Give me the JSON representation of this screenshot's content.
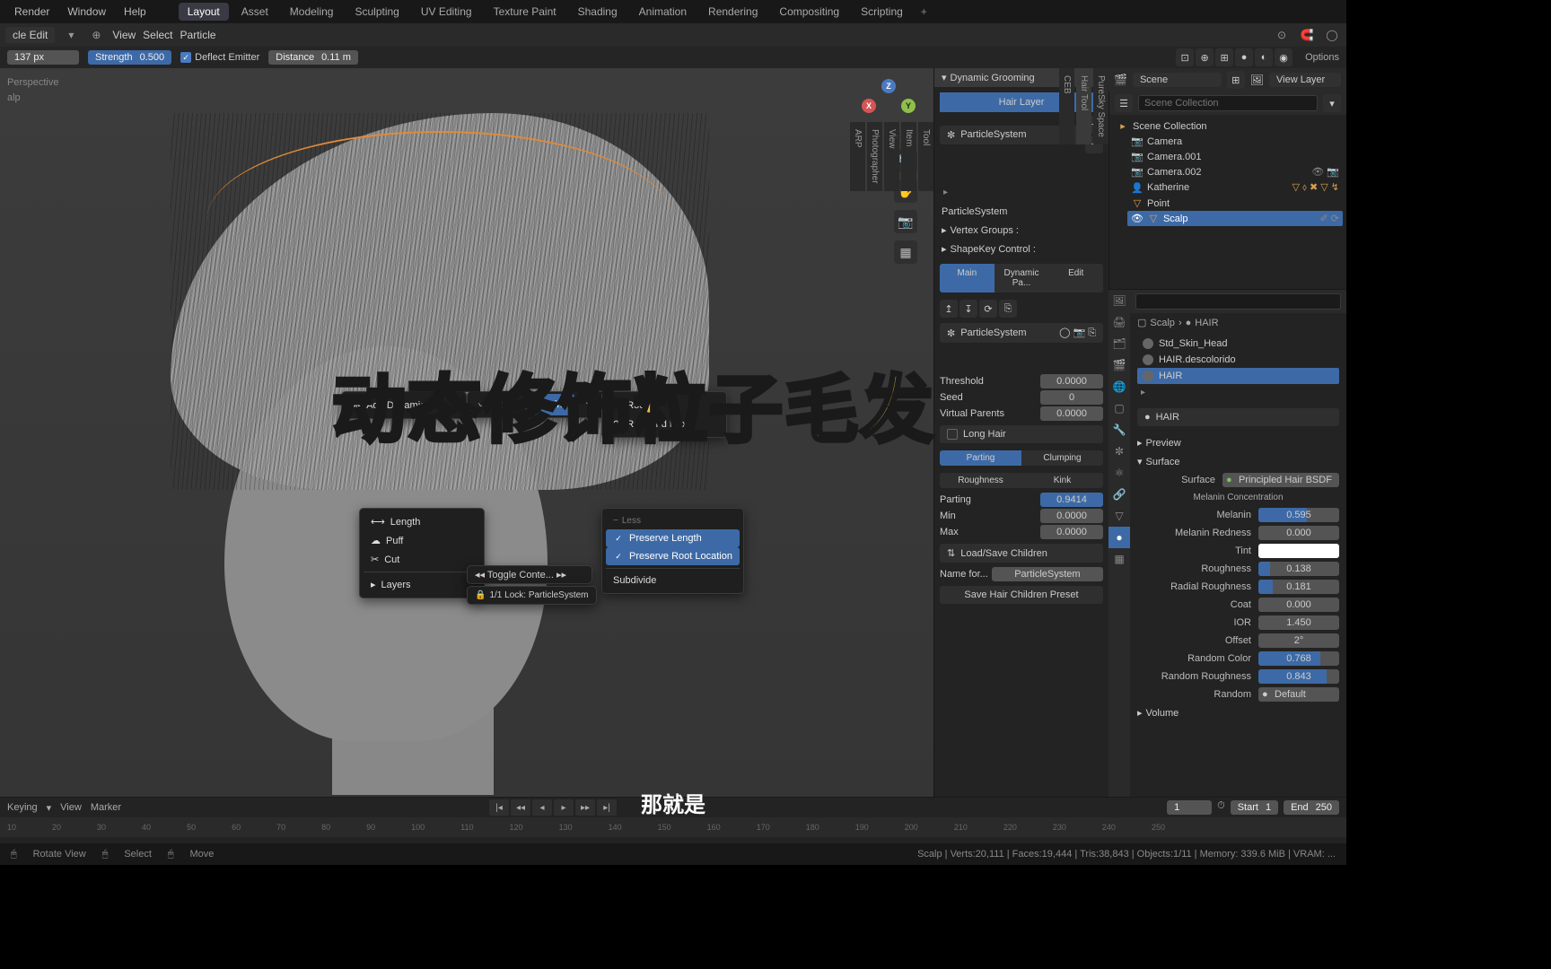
{
  "topmenu": [
    "Render",
    "Window",
    "Help"
  ],
  "workspaces": [
    "Layout",
    "Asset",
    "Modeling",
    "Sculpting",
    "UV Editing",
    "Texture Paint",
    "Shading",
    "Animation",
    "Rendering",
    "Compositing",
    "Scripting"
  ],
  "scene_selector": "Scene",
  "viewlayer": "View Layer",
  "header2": {
    "mode": "cle Edit",
    "menus": [
      "View",
      "Select",
      "Particle"
    ]
  },
  "header3": {
    "radius": {
      "label": "",
      "value": "137 px"
    },
    "strength": {
      "label": "Strength",
      "value": "0.500"
    },
    "deflect": "Deflect Emitter",
    "distance": {
      "label": "Distance",
      "value": "0.11 m"
    }
  },
  "vp_info": [
    "Perspective",
    "alp"
  ],
  "sidetabs_vp": [
    "Tool",
    "Item",
    "View",
    "Photographer",
    "ARP"
  ],
  "ctx": {
    "menu1": [
      {
        "ico": "✼",
        "label": "Add Dynamics"
      }
    ],
    "menu2": [
      "Path",
      "Point",
      "Tip"
    ],
    "menu3": {
      "head": "Root",
      "items": [
        "Root and Next"
      ]
    },
    "menu4": [
      "Length",
      "Puff",
      "Cut",
      "Layers"
    ],
    "menu5": {
      "head": "Less",
      "checks": [
        "Preserve Length",
        "Preserve Root Location"
      ],
      "items": [
        "Subdivide"
      ]
    },
    "toggle": "Toggle Conte...",
    "lock": "1/1 Lock: ParticleSystem"
  },
  "big_title": "动态修饰粒子毛发",
  "subtitle": "那就是",
  "dyn_groom": {
    "title": "Dynamic Grooming",
    "layer_btn": "Hair Layer",
    "psys": "ParticleSystem",
    "psys_label": "ParticleSystem",
    "groups": [
      "Vertex Groups :",
      "ShapeKey Control :"
    ],
    "tabs": [
      "Main",
      "Dynamic Pa...",
      "Edit"
    ],
    "psys_dd": "ParticleSystem",
    "props": [
      {
        "l": "Threshold",
        "v": "0.0000"
      },
      {
        "l": "Seed",
        "v": "0"
      },
      {
        "l": "Virtual Parents",
        "v": "0.0000"
      }
    ],
    "longhair": "Long Hair",
    "pair1": [
      "Parting",
      "Clumping"
    ],
    "pair2": [
      "Roughness",
      "Kink"
    ],
    "parting": [
      {
        "l": "Parting",
        "v": "0.9414",
        "b": true
      },
      {
        "l": "Min",
        "v": "0.0000"
      },
      {
        "l": "Max",
        "v": "0.0000"
      }
    ],
    "loadsave": "Load/Save Children",
    "namefor": "Name for...",
    "namefor_v": "ParticleSystem",
    "savepreset": "Save Hair Children Preset",
    "sidetabs": [
      "PureSky Space",
      "Hair Tool",
      "CEB",
      ""
    ]
  },
  "outliner": {
    "root": "Scene Collection",
    "items": [
      {
        "ico": "📷",
        "label": "Camera"
      },
      {
        "ico": "📷",
        "label": "Camera.001"
      },
      {
        "ico": "📷",
        "label": "Camera.002"
      },
      {
        "ico": "👤",
        "label": "Katherine",
        "ext": true
      },
      {
        "ico": "▽",
        "label": "Point"
      },
      {
        "ico": "▽",
        "label": "Scalp",
        "sel": true
      }
    ]
  },
  "props": {
    "breadcrumb": [
      "Scalp",
      "HAIR"
    ],
    "materials": [
      "Std_Skin_Head",
      "HAIR.descolorido",
      "HAIR"
    ],
    "mat_active": "HAIR",
    "sections": {
      "preview": "Preview",
      "surface": "Surface",
      "surface_type": "Principled Hair BSDF",
      "melanin_hd": "Melanin Concentration",
      "sliders": [
        {
          "l": "Melanin",
          "v": "0.595",
          "f": 0.6
        },
        {
          "l": "Melanin Redness",
          "v": "0.000",
          "f": 0
        },
        {
          "l": "Tint",
          "swatch": true
        },
        {
          "l": "Roughness",
          "v": "0.138",
          "f": 0.14
        },
        {
          "l": "Radial Roughness",
          "v": "0.181",
          "f": 0.18
        },
        {
          "l": "Coat",
          "v": "0.000",
          "f": 0
        },
        {
          "l": "IOR",
          "v": "1.450",
          "f": 0
        },
        {
          "l": "Offset",
          "v": "2°",
          "f": 0
        },
        {
          "l": "Random Color",
          "v": "0.768",
          "f": 0.77
        },
        {
          "l": "Random Roughness",
          "v": "0.843",
          "f": 0.84
        },
        {
          "l": "Random",
          "v": "Default",
          "f": 0
        }
      ],
      "volume": "Volume"
    }
  },
  "timeline": {
    "menus": [
      "Keying",
      "View",
      "Marker"
    ],
    "cur": "1",
    "start_l": "Start",
    "start": "1",
    "end_l": "End",
    "end": "250",
    "ticks": [
      "10",
      "20",
      "30",
      "40",
      "50",
      "60",
      "70",
      "80",
      "90",
      "100",
      "110",
      "120",
      "130",
      "140",
      "150",
      "160",
      "170",
      "180",
      "190",
      "200",
      "210",
      "220",
      "230",
      "240",
      "250"
    ]
  },
  "statusbar": {
    "left": [
      "Rotate View",
      "Select",
      "Move"
    ],
    "right": "Scalp | Verts:20,111 | Faces:19,444 | Tris:38,843 | Objects:1/11 | Memory: 339.6 MiB | VRAM: ..."
  },
  "options_label": "Options"
}
